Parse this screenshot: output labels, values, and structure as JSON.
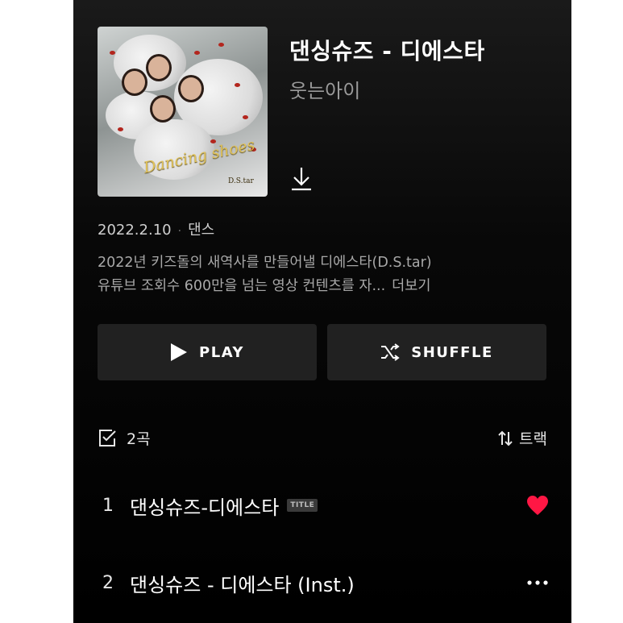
{
  "album": {
    "title": "댄싱슈즈 - 디에스타",
    "artist": "웃는아이",
    "cover_text": "Dancing shoes",
    "cover_subtext": "D.S.tar",
    "release_date": "2022.2.10",
    "genre": "댄스",
    "description_line1": "2022년 키즈돌의 새역사를 만들어낼 디에스타(D.S.tar)",
    "description_line2": "유튜브 조회수 600만을 넘는 영상 컨텐츠를 자...",
    "more_label": "더보기"
  },
  "actions": {
    "play_label": "PLAY",
    "shuffle_label": "SHUFFLE"
  },
  "tracklist": {
    "count_label": "2곡",
    "sort_label": "트랙",
    "tracks": [
      {
        "number": "1",
        "title": "댄싱슈즈-디에스타",
        "badge": "TITLE",
        "liked": true
      },
      {
        "number": "2",
        "title": "댄싱슈즈 - 디에스타 (Inst.)",
        "liked": false
      }
    ]
  },
  "colors": {
    "like": "#ff1744",
    "background": "#000000",
    "button": "#212121"
  }
}
